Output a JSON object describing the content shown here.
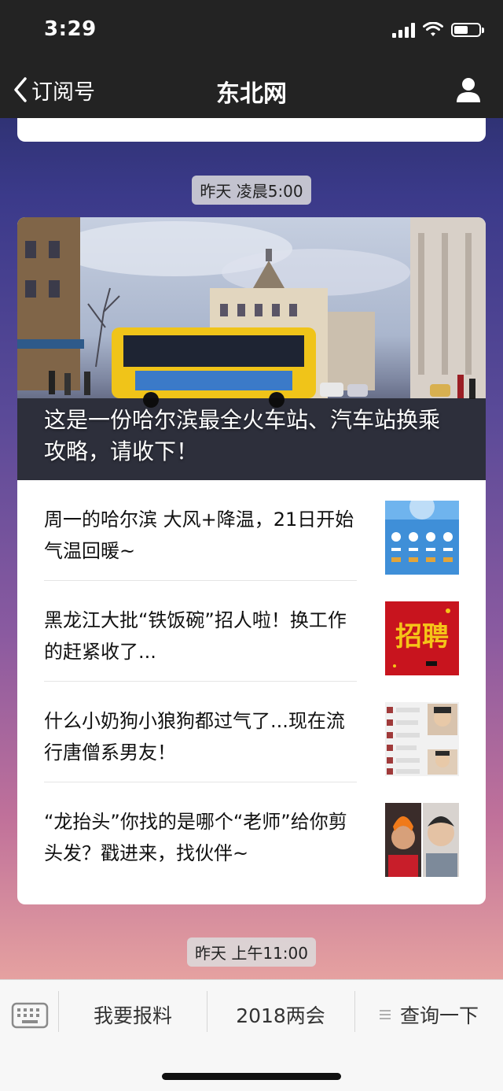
{
  "status_bar": {
    "time": "3:29",
    "battery_level": 0.55
  },
  "nav": {
    "back_label": "订阅号",
    "title": "东北网"
  },
  "timestamps": [
    "昨天 凌晨5:00",
    "昨天 上午11:00"
  ],
  "article_group": {
    "main": {
      "title": "这是一份哈尔滨最全火车站、汽车站换乘攻略，请收下！"
    },
    "items": [
      {
        "title": "周一的哈尔滨 大风+降温，21日开始气温回暖~",
        "thumb": "weather-forecast-thumb"
      },
      {
        "title": "黑龙江大批“铁饭碗”招人啦！换工作的赶紧收了...",
        "thumb": "recruitment-thumb",
        "thumb_text": "招聘"
      },
      {
        "title": "什么小奶狗小狼狗都过气了...现在流行唐僧系男友！",
        "thumb": "chat-screenshot-thumb"
      },
      {
        "title": "“龙抬头”你找的是哪个“老师”给你剪头发？戳进来，找伙伴~",
        "thumb": "haircut-photo-thumb"
      }
    ]
  },
  "bottom_menu": {
    "items": [
      {
        "label": "我要报料"
      },
      {
        "label": "2018两会"
      },
      {
        "label": "查询一下",
        "icon": "menu-list-icon"
      }
    ]
  },
  "colors": {
    "bar_bg": "#232323",
    "recruit_red": "#c8141e",
    "recruit_gold": "#f5c418"
  }
}
